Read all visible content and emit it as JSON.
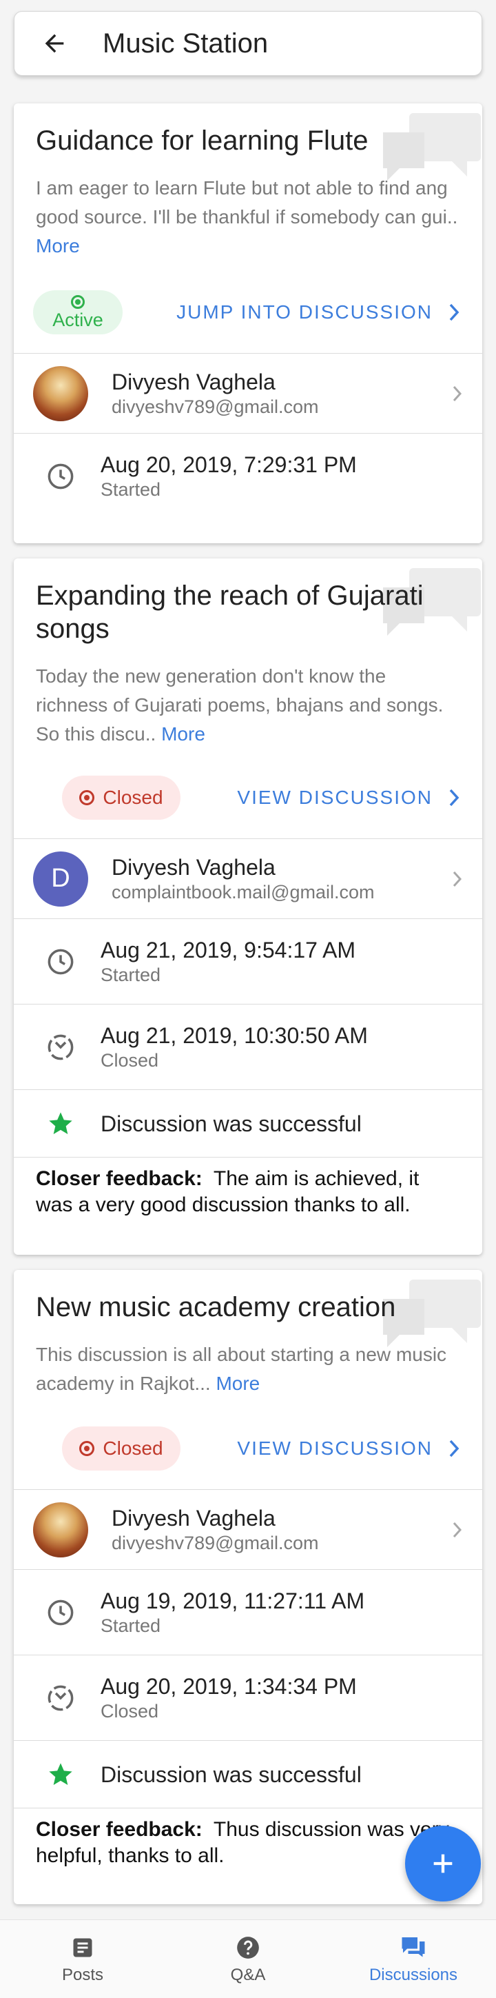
{
  "header": {
    "title": "Music Station",
    "back_icon": "arrow-left-icon"
  },
  "discussions": [
    {
      "title": "Guidance for learning Flute",
      "description": "I am eager to learn Flute but not able to find ang good source. I'll be thankful if somebody can gui..",
      "more_label": "More",
      "status": "Active",
      "action_label": "JUMP INTO DISCUSSION",
      "user": {
        "name": "Divyesh Vaghela",
        "email": "divyeshv789@gmail.com",
        "avatar": "photo"
      },
      "started": {
        "time": "Aug 20, 2019, 7:29:31 PM",
        "label": "Started"
      }
    },
    {
      "title": "Expanding the reach of Gujarati songs",
      "description": "Today the new generation don't know the richness of Gujarati poems, bhajans and songs. So this discu..",
      "more_label": "More",
      "status": "Closed",
      "action_label": "VIEW DISCUSSION",
      "user": {
        "name": "Divyesh Vaghela",
        "email": "complaintbook.mail@gmail.com",
        "avatar_letter": "D"
      },
      "started": {
        "time": "Aug 21, 2019, 9:54:17 AM",
        "label": "Started"
      },
      "closed": {
        "time": "Aug 21, 2019, 10:30:50 AM",
        "label": "Closed"
      },
      "result": "Discussion was successful",
      "feedback_label": "Closer feedback:",
      "feedback": "The aim is achieved, it was a very good discussion thanks to all."
    },
    {
      "title": "New music academy creation",
      "description": "This discussion is all about starting a new music academy in Rajkot...",
      "more_label": "More",
      "status": "Closed",
      "action_label": "VIEW DISCUSSION",
      "user": {
        "name": "Divyesh Vaghela",
        "email": "divyeshv789@gmail.com",
        "avatar": "photo"
      },
      "started": {
        "time": "Aug 19, 2019, 11:27:11 AM",
        "label": "Started"
      },
      "closed": {
        "time": "Aug 20, 2019, 1:34:34 PM",
        "label": "Closed"
      },
      "result": "Discussion was successful",
      "feedback_label": "Closer feedback:",
      "feedback": "Thus discussion was very helpful, thanks to all."
    }
  ],
  "fab": {
    "icon": "plus-icon"
  },
  "bottom_nav": {
    "items": [
      {
        "label": "Posts",
        "icon": "posts-icon"
      },
      {
        "label": "Q&A",
        "icon": "help-circle-icon"
      },
      {
        "label": "Discussions",
        "icon": "chat-bubbles-icon",
        "active": true
      }
    ]
  },
  "colors": {
    "accent": "#3c7ddc",
    "active": "#2fb14c",
    "closed": "#c0392b",
    "fab": "#2f7ef0",
    "star": "#1fae49"
  }
}
